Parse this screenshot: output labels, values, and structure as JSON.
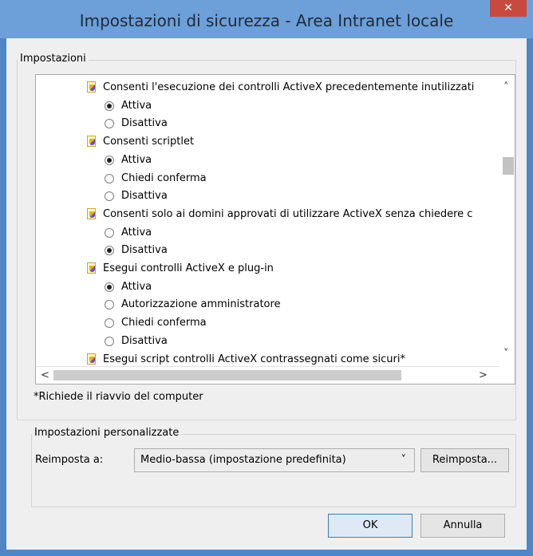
{
  "window": {
    "title": "Impostazioni di sicurezza - Area Intranet locale",
    "close_glyph": "✕"
  },
  "settings_group": {
    "label": "Impostazioni"
  },
  "list_items": [
    {
      "kind": "category",
      "text": "Consenti l'esecuzione dei controlli ActiveX precedentemente inutilizzati"
    },
    {
      "kind": "option",
      "text": "Attiva",
      "checked": true
    },
    {
      "kind": "option",
      "text": "Disattiva",
      "checked": false
    },
    {
      "kind": "category",
      "text": "Consenti scriptlet"
    },
    {
      "kind": "option",
      "text": "Attiva",
      "checked": true
    },
    {
      "kind": "option",
      "text": "Chiedi conferma",
      "checked": false
    },
    {
      "kind": "option",
      "text": "Disattiva",
      "checked": false
    },
    {
      "kind": "category",
      "text": "Consenti solo ai domini approvati di utilizzare ActiveX senza chiedere c"
    },
    {
      "kind": "option",
      "text": "Attiva",
      "checked": false
    },
    {
      "kind": "option",
      "text": "Disattiva",
      "checked": true
    },
    {
      "kind": "category",
      "text": "Esegui controlli ActiveX e plug-in"
    },
    {
      "kind": "option",
      "text": "Attiva",
      "checked": true
    },
    {
      "kind": "option",
      "text": "Autorizzazione amministratore",
      "checked": false
    },
    {
      "kind": "option",
      "text": "Chiedi conferma",
      "checked": false
    },
    {
      "kind": "option",
      "text": "Disattiva",
      "checked": false
    },
    {
      "kind": "category",
      "text": "Esegui script controlli ActiveX contrassegnati come sicuri*"
    }
  ],
  "scroll": {
    "up": "˄",
    "down": "˅",
    "left": "<",
    "right": ">"
  },
  "footnote": "*Richiede il riavvio del computer",
  "custom_group": {
    "label": "Impostazioni personalizzate",
    "reset_label": "Reimposta a:",
    "selected_level": "Medio-bassa (impostazione predefinita)",
    "dropdown_glyph": "˅",
    "reset_button": "Reimposta..."
  },
  "buttons": {
    "ok": "OK",
    "cancel": "Annulla"
  },
  "colors": {
    "titlebar": "#6d9fd8",
    "frame": "#4f86c6",
    "close": "#c84a3e"
  }
}
